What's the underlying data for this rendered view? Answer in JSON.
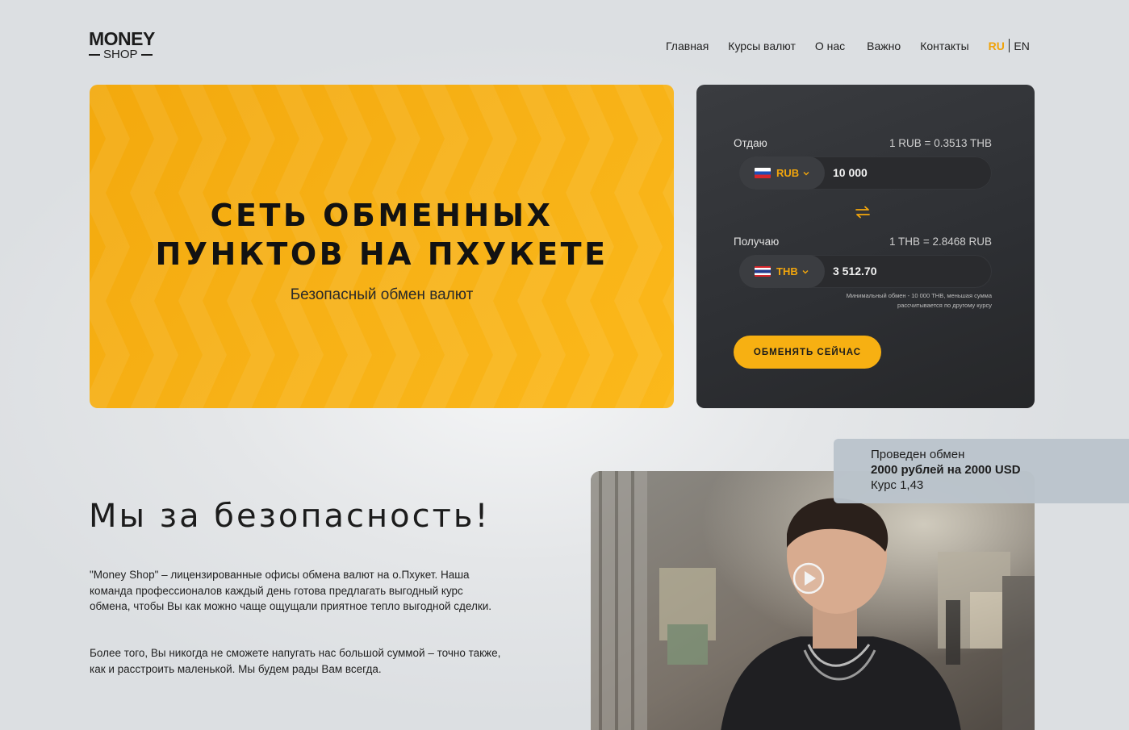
{
  "brand": {
    "logo_top": "MONEY",
    "logo_bottom": "SHOP"
  },
  "nav": {
    "items": [
      "Главная",
      "Курсы валют",
      "О нас",
      "Важно",
      "Контакты"
    ],
    "lang_ru": "RU",
    "lang_en": "EN",
    "active_lang": "RU"
  },
  "hero": {
    "title_line1": "СЕТЬ ОБМЕННЫХ",
    "title_line2": "ПУНКТОВ НА ПХУКЕТЕ",
    "subtitle": "Безопасный обмен валют"
  },
  "exchange": {
    "give_label": "Отдаю",
    "give_rate": "1 RUB = 0.3513 THB",
    "give_currency": "RUB",
    "give_amount": "10 000",
    "receive_label": "Получаю",
    "receive_rate": "1 THB = 2.8468 RUB",
    "receive_currency": "THB",
    "receive_amount": "3 512.70",
    "note_line1": "Минимальный обмен - 10 000 THB, меньшая сумма",
    "note_line2": "рассчитывается по другому курсу",
    "button": "ОБМЕНЯТЬ СЕЙЧАС"
  },
  "security": {
    "title": "Мы за безопасность!",
    "p1": "\"Money Shop\" – лицензированные офисы обмена валют на о.Пхукет. Наша команда профессионалов каждый день готова предлагать выгодный курс обмена, чтобы Вы как можно чаще ощущали приятное тепло выгодной сделки.",
    "p2": "Более того, Вы никогда не сможете напугать нас большой суммой – точно также, как и расстроить маленькой. Мы будем рады Вам всегда."
  },
  "toast": {
    "line1": "Проведен обмен",
    "line2": "2000 рублей на 2000 USD",
    "line3": "Курс 1,43"
  },
  "colors": {
    "accent": "#f7b012",
    "dark_card": "#2d2f33",
    "toast_bg": "#bac4cc"
  },
  "icons": {
    "swap": "swap-arrows-icon",
    "chevron": "chevron-down-icon",
    "play": "play-icon"
  }
}
